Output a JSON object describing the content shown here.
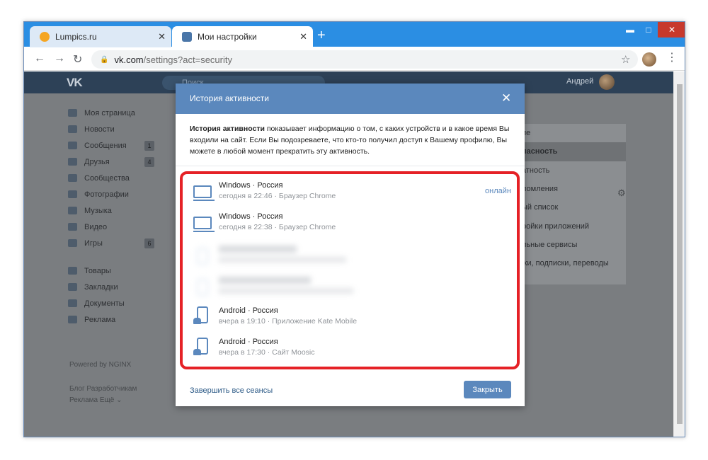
{
  "browser": {
    "tabs": [
      {
        "label": "Lumpics.ru",
        "favicon_color": "#f5a623"
      },
      {
        "label": "Мои настройки",
        "favicon_color": "#4a76a8"
      }
    ],
    "new_tab_symbol": "+",
    "address_host": "vk.com",
    "address_path": "/settings?act=security"
  },
  "vk": {
    "logo": "VK",
    "search_placeholder": "Поиск",
    "user_name": "Андрей",
    "menu": [
      {
        "label": "Моя страница"
      },
      {
        "label": "Новости"
      },
      {
        "label": "Сообщения",
        "badge": "1"
      },
      {
        "label": "Друзья",
        "badge": "4"
      },
      {
        "label": "Сообщества"
      },
      {
        "label": "Фотографии"
      },
      {
        "label": "Музыка"
      },
      {
        "label": "Видео"
      },
      {
        "label": "Игры",
        "badge": "6"
      },
      {
        "label": "Товары"
      },
      {
        "label": "Закладки"
      },
      {
        "label": "Документы"
      },
      {
        "label": "Реклама"
      }
    ],
    "powered": "Powered by NGINX",
    "footer_line1": "Блог   Разработчикам",
    "footer_line2": "Реклама   Ещё ⌄",
    "right_menu": [
      "ие",
      "пасность",
      "атность",
      "ломления",
      "ый список",
      "ройки приложений",
      "льные сервисы",
      "жи, подписки, переводы"
    ]
  },
  "modal": {
    "title": "История активности",
    "desc_bold": "История активности",
    "desc_rest": " показывает информацию о том, с каких устройств и в какое время Вы входили на сайт. Если Вы подозреваете, что кто-то получил доступ к Вашему профилю, Вы можете в любой момент прекратить эту активность.",
    "sessions": [
      {
        "title": "Windows · Россия",
        "detail": "сегодня в 22:46 · Браузер Chrome",
        "status": "онлайн",
        "device": "laptop"
      },
      {
        "title": "Windows · Россия",
        "detail": "сегодня в 22:38 · Браузер Chrome",
        "device": "laptop"
      },
      {
        "title": "Android · Россия",
        "detail": "вчера в 19:10 · Приложение Kate Mobile",
        "device": "android"
      },
      {
        "title": "Android · Россия",
        "detail": "вчера в 17:30 · Сайт Moosic",
        "device": "android"
      }
    ],
    "end_all_label": "Завершить все сеансы",
    "close_label": "Закрыть"
  },
  "colors": {
    "vk_blue": "#5b88bd",
    "highlight_red": "#e52126",
    "chrome_titlebar": "#2b8ee3"
  }
}
